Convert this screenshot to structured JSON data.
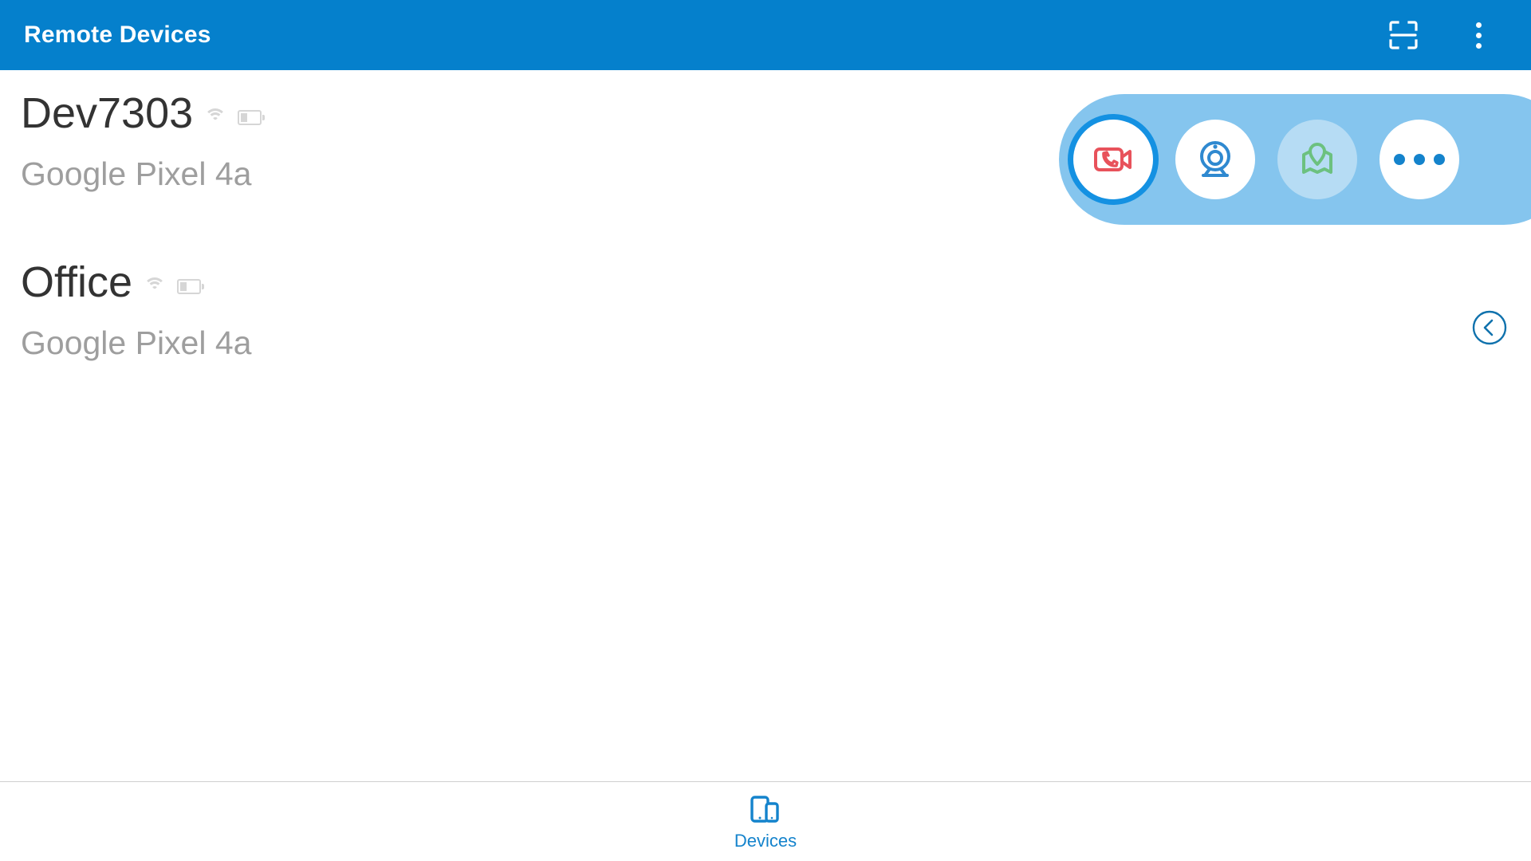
{
  "header": {
    "title": "Remote Devices",
    "actions": [
      {
        "name": "scan-qr-icon",
        "label": "Scan"
      },
      {
        "name": "overflow-menu-icon",
        "label": "More options"
      }
    ]
  },
  "devices": [
    {
      "name": "Dev7303",
      "model": "Google Pixel 4a",
      "wifi_icon": "wifi-icon",
      "battery_icon": "battery-low-icon"
    },
    {
      "name": "Office",
      "model": "Google Pixel 4a",
      "wifi_icon": "wifi-icon",
      "battery_icon": "battery-low-icon"
    }
  ],
  "action_pill": {
    "buttons": [
      {
        "name": "video-call-button",
        "icon": "video-call-icon",
        "label": "Video call",
        "state": "selected",
        "color": "#e8525b"
      },
      {
        "name": "webcam-button",
        "icon": "webcam-icon",
        "label": "Webcam",
        "state": "default",
        "color": "#2f89d0"
      },
      {
        "name": "map-location-button",
        "icon": "map-location-icon",
        "label": "Location",
        "state": "tinted",
        "color": "#6cc17f"
      },
      {
        "name": "more-actions-button",
        "icon": "more-horizontal-icon",
        "label": "More",
        "state": "default",
        "color": "#1483cc"
      }
    ],
    "background_color": "#85c5ee",
    "selection_ring_color": "#1491e2"
  },
  "collapse": {
    "icon": "chevron-left-circle-icon",
    "label": "Collapse actions"
  },
  "bottom_nav": {
    "items": [
      {
        "name": "nav-devices",
        "icon": "devices-icon",
        "label": "Devices",
        "active": true
      }
    ],
    "active_color": "#1483cc"
  },
  "colors": {
    "appbar": "#0580cc",
    "device_name": "#333333",
    "device_model": "#9e9e9e",
    "divider": "#cfcfcf"
  }
}
